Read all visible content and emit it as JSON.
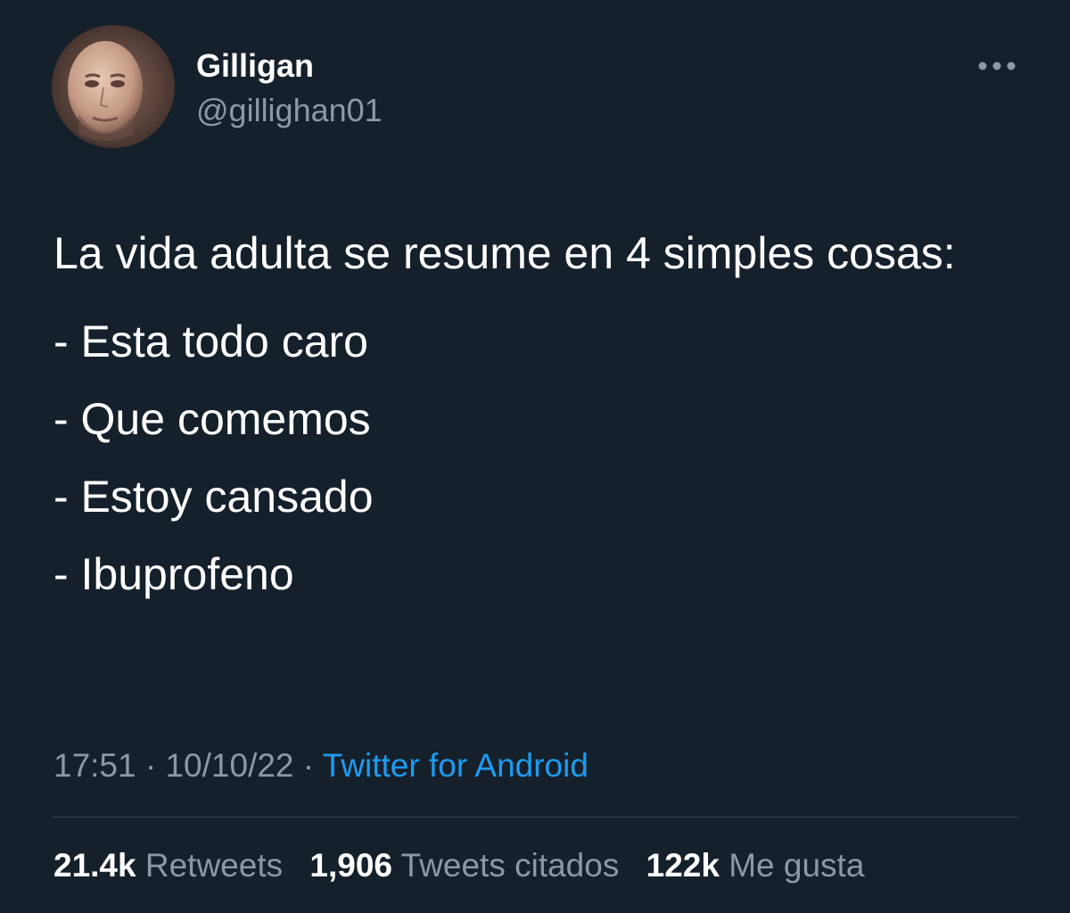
{
  "author": {
    "display_name": "Gilligan",
    "handle": "@gillighan01"
  },
  "menu_icon": "more-horizontal-icon",
  "tweet": {
    "intro": "La vida adulta se resume en 4 simples cosas:",
    "items": [
      "- Esta todo caro",
      "- Que comemos",
      "- Estoy cansado",
      "- Ibuprofeno"
    ]
  },
  "meta": {
    "time": "17:51",
    "separator": "·",
    "date": "10/10/22",
    "source": "Twitter for Android"
  },
  "stats": {
    "retweets_count": "21.4k",
    "retweets_label": "Retweets",
    "quotes_count": "1,906",
    "quotes_label": "Tweets citados",
    "likes_count": "122k",
    "likes_label": "Me gusta"
  },
  "colors": {
    "background": "#15202b",
    "secondary_text": "#8b98a5",
    "link": "#1d9bf0",
    "divider": "#38444d"
  }
}
